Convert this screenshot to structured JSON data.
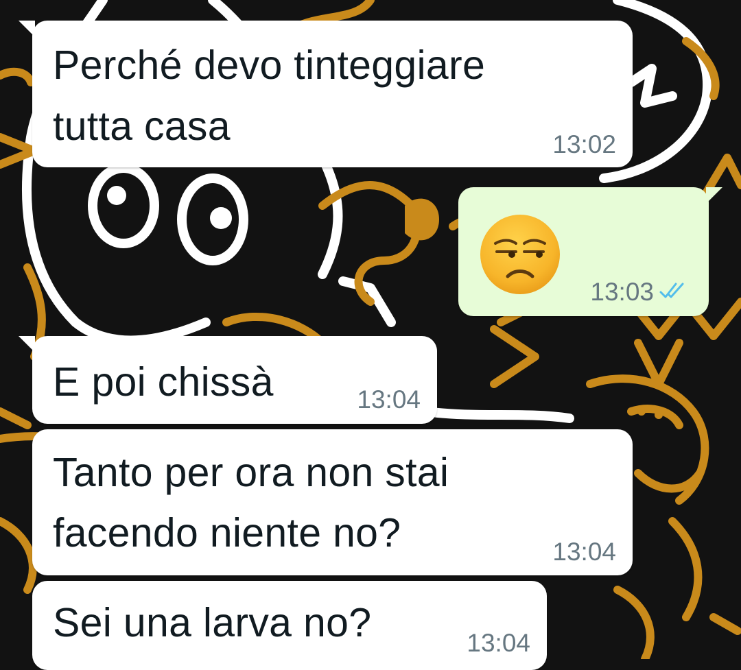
{
  "chat": {
    "messages": [
      {
        "direction": "incoming",
        "text_lines": [
          "Perché devo tinteggiare",
          "tutta casa"
        ],
        "time": "13:02"
      },
      {
        "direction": "outgoing",
        "emoji": "unamused-face",
        "time": "13:03",
        "status": "read",
        "status_color": "#53bdeb"
      },
      {
        "direction": "incoming",
        "text_lines": [
          "E poi chissà"
        ],
        "time": "13:04"
      },
      {
        "direction": "incoming",
        "text_lines": [
          "Tanto per ora non stai",
          "facendo niente no?"
        ],
        "time": "13:04"
      },
      {
        "direction": "incoming",
        "text_lines": [
          "Sei una larva no?"
        ],
        "time": "13:04"
      }
    ]
  },
  "theme": {
    "wallpaper_bg": "#121212",
    "wallpaper_gold": "#c98a1b",
    "wallpaper_white": "#ffffff",
    "incoming_bubble": "#ffffff",
    "outgoing_bubble": "#e7fcd7",
    "time_color": "#667781"
  }
}
